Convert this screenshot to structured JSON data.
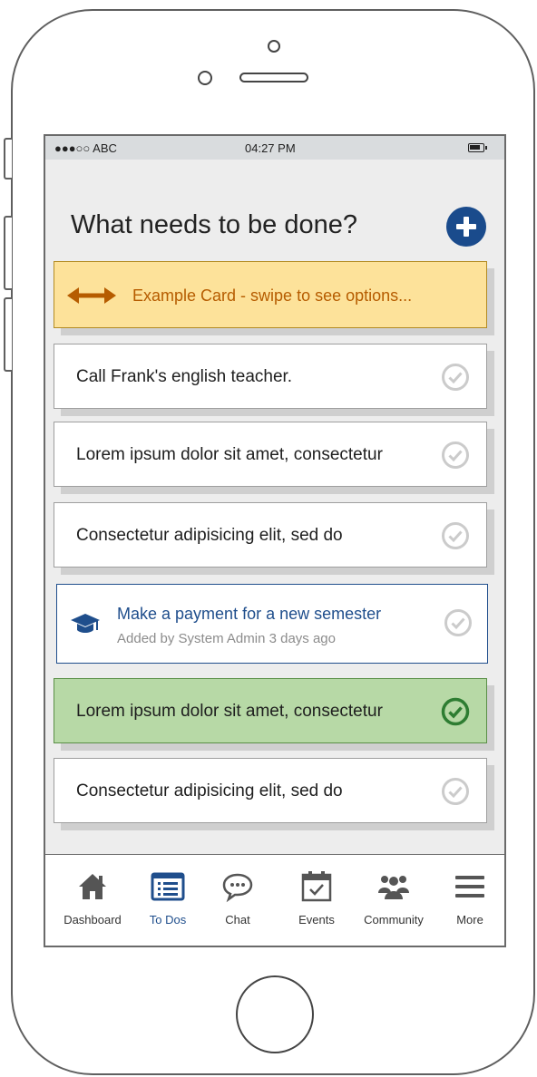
{
  "status_bar": {
    "carrier": "●●●○○ ABC",
    "time": "04:27 PM"
  },
  "page": {
    "title": "What needs to be done?"
  },
  "example_card": {
    "label": "Example Card - swipe to see options..."
  },
  "todos": [
    {
      "text": "Call Frank's english teacher."
    },
    {
      "text": "Lorem ipsum dolor sit amet, consectetur"
    },
    {
      "text": "Consectetur adipisicing elit, sed do"
    },
    {
      "text": "Make a payment for a new semester",
      "subtext": "Added by System Admin 3 days ago"
    },
    {
      "text": "Lorem ipsum dolor sit amet, consectetur",
      "completed": true
    },
    {
      "text": "Consectetur adipisicing elit, sed do"
    }
  ],
  "tab_bar": {
    "tabs": [
      {
        "label": "Dashboard",
        "icon": "home-icon"
      },
      {
        "label": "To Dos",
        "icon": "list-icon",
        "active": true
      },
      {
        "label": "Chat",
        "icon": "chat-bubble-icon"
      },
      {
        "label": "Events",
        "icon": "calendar-icon"
      },
      {
        "label": "Community",
        "icon": "people-icon"
      },
      {
        "label": "More",
        "icon": "menu-icon"
      }
    ]
  },
  "colors": {
    "accent": "#1a4b8c",
    "example_card_bg": "#fde29a",
    "example_card_text": "#b65c00",
    "completed_bg": "#b7d9a6",
    "completed_check": "#2e7d32"
  }
}
